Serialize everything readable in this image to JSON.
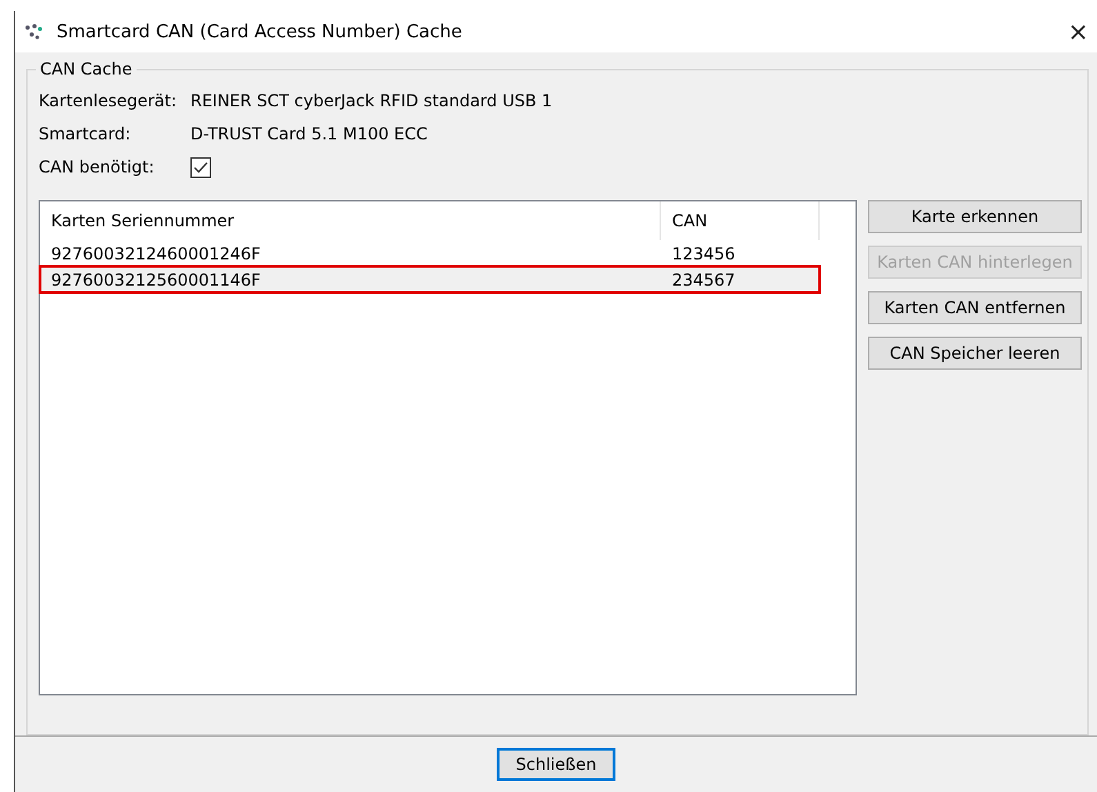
{
  "window": {
    "title": "Smartcard CAN (Card Access Number) Cache",
    "close": "×"
  },
  "group": {
    "title": "CAN Cache",
    "fields": [
      {
        "kind": "text",
        "label": "Kartenlesegerät:",
        "value": "REINER SCT cyberJack RFID standard USB 1"
      },
      {
        "kind": "text",
        "label": "Smartcard:",
        "value": "D-TRUST Card 5.1 M100 ECC"
      },
      {
        "kind": "checkbox",
        "label": "CAN benötigt:",
        "checked": true
      }
    ]
  },
  "table": {
    "columns": [
      "Karten Seriennummer",
      "CAN"
    ],
    "rows": [
      {
        "cells": [
          "9276003212460001246F",
          "123456"
        ],
        "selected": false,
        "highlighted": false
      },
      {
        "cells": [
          "9276003212560001146F",
          "234567"
        ],
        "selected": true,
        "highlighted": true
      }
    ]
  },
  "actions": [
    {
      "label": "Karte erkennen",
      "disabled": false
    },
    {
      "label": "Karten CAN hinterlegen",
      "disabled": true
    },
    {
      "label": "Karten CAN entfernen",
      "disabled": false
    },
    {
      "label": "CAN Speicher leeren",
      "disabled": false
    }
  ],
  "footer": {
    "button": "Schließen"
  }
}
